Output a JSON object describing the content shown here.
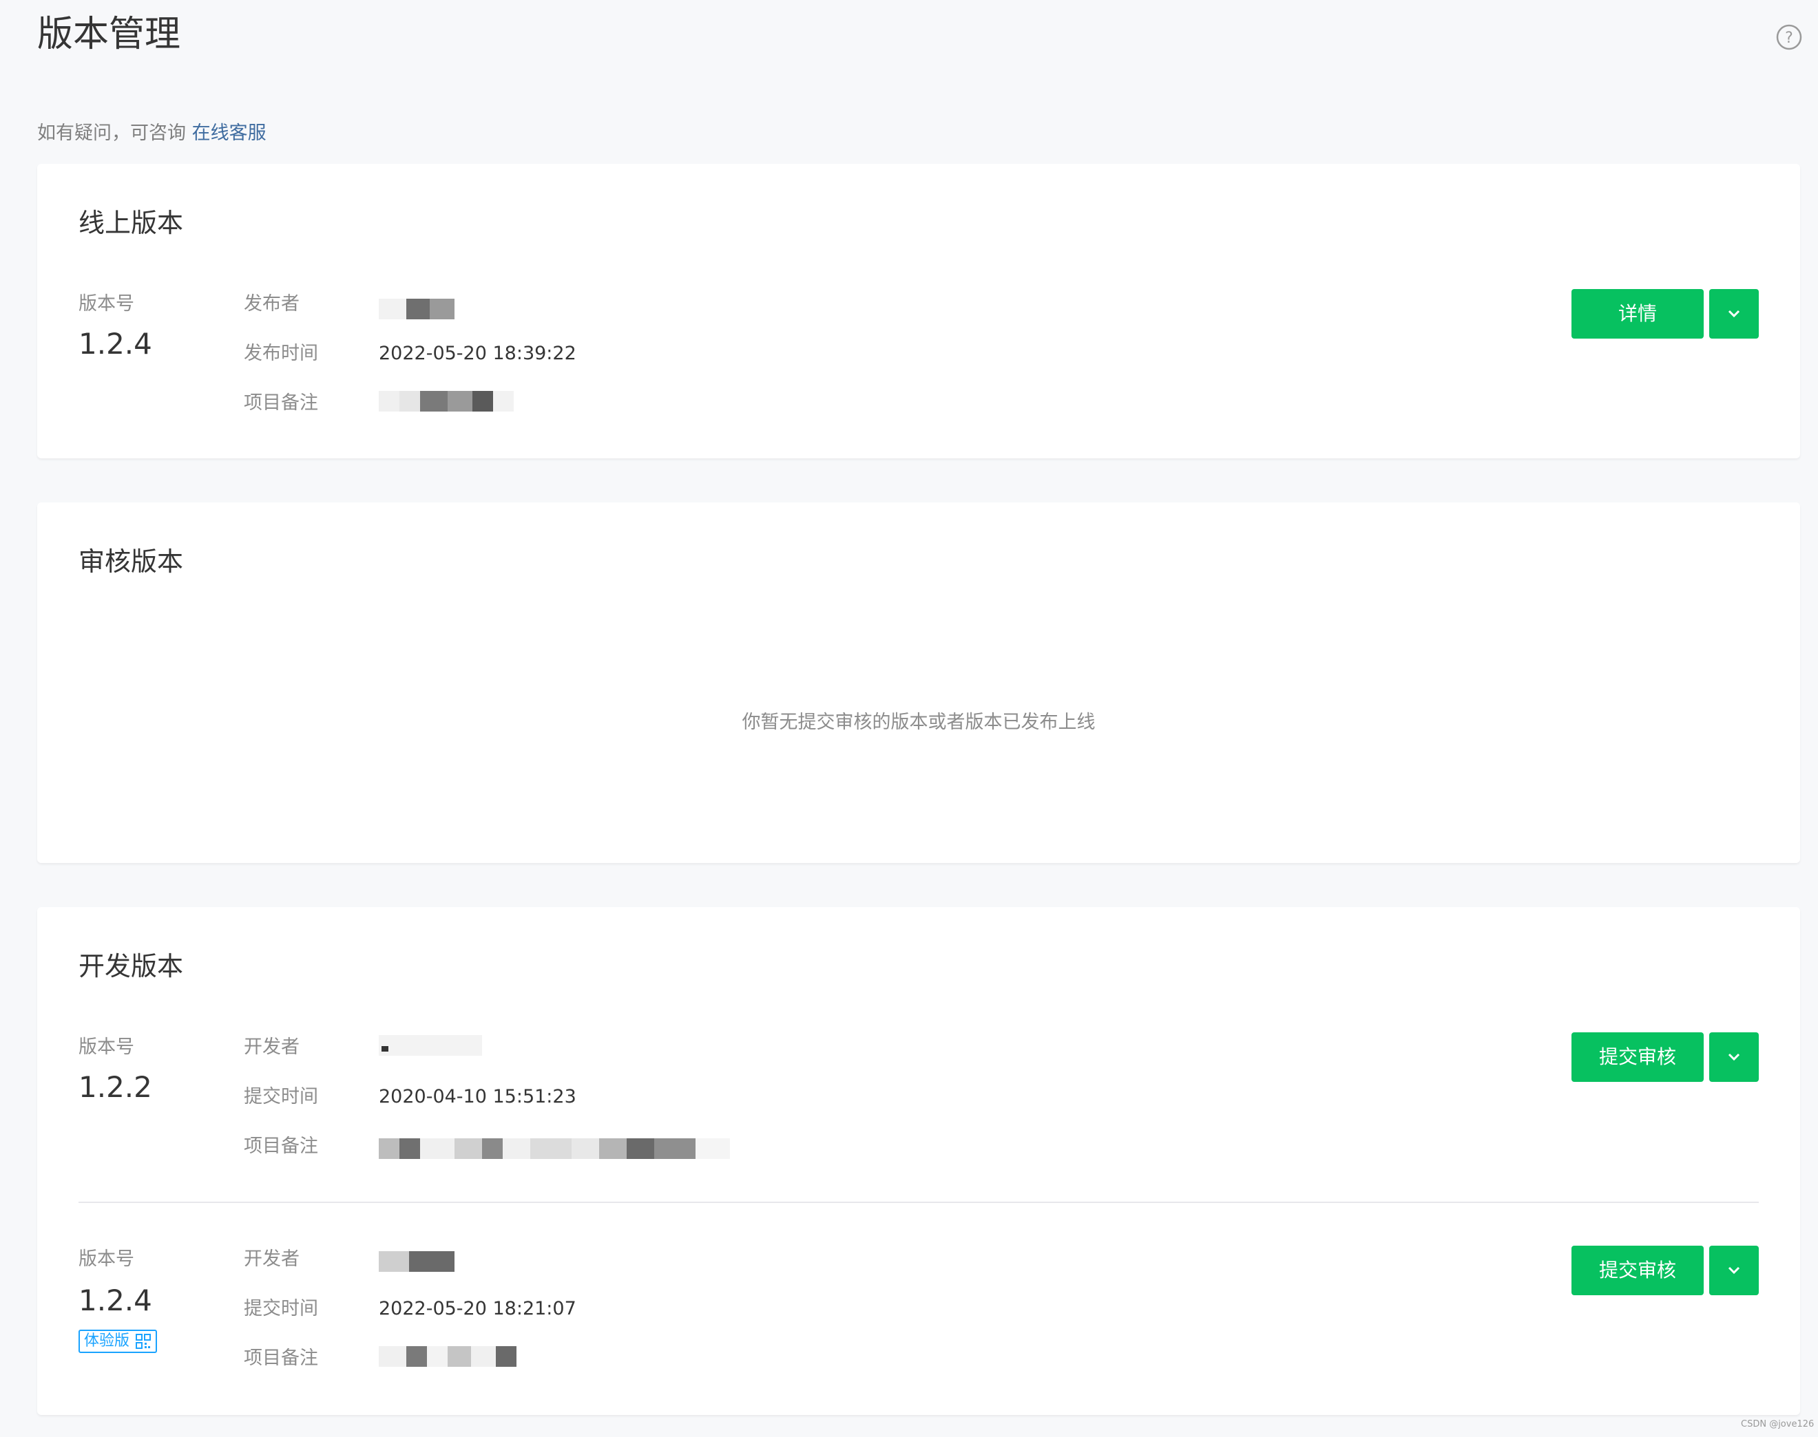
{
  "page": {
    "title": "版本管理",
    "notice_prefix": "如有疑问，可咨询 ",
    "notice_link": "在线客服",
    "help_icon": "question-circle-icon"
  },
  "online": {
    "title": "线上版本",
    "version_label": "版本号",
    "version": "1.2.4",
    "publisher_label": "发布者",
    "publish_time_label": "发布时间",
    "publish_time": "2022-05-20 18:39:22",
    "remark_label": "项目备注",
    "detail_button": "详情",
    "dropdown_icon": "chevron-down-icon"
  },
  "review": {
    "title": "审核版本",
    "empty_text": "你暂无提交审核的版本或者版本已发布上线"
  },
  "dev": {
    "title": "开发版本",
    "items": [
      {
        "version_label": "版本号",
        "version": "1.2.2",
        "developer_label": "开发者",
        "submit_time_label": "提交时间",
        "submit_time": "2020-04-10 15:51:23",
        "remark_label": "项目备注",
        "submit_button": "提交审核"
      },
      {
        "version_label": "版本号",
        "version": "1.2.4",
        "tag": "体验版",
        "tag_icon": "qrcode-icon",
        "developer_label": "开发者",
        "submit_time_label": "提交时间",
        "submit_time": "2022-05-20 18:21:07",
        "remark_label": "项目备注",
        "submit_button": "提交审核"
      }
    ]
  },
  "colors": {
    "primary_button": "#07c160",
    "link": "#3f6ca0",
    "tag": "#1aa3ff",
    "background": "#f7f8fa"
  },
  "watermark": "CSDN @jove126"
}
